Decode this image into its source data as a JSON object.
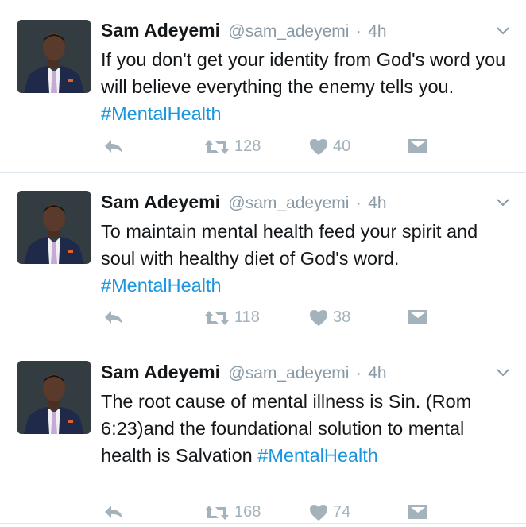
{
  "tweets": [
    {
      "name": "Sam Adeyemi",
      "handle": "@sam_adeyemi",
      "separator": "·",
      "time": "4h",
      "text": "If you don't get your identity from God's word you will believe everything the enemy tells you.",
      "hashtag": "#MentalHealth",
      "retweets": "128",
      "likes": "40"
    },
    {
      "name": "Sam Adeyemi",
      "handle": "@sam_adeyemi",
      "separator": "·",
      "time": "4h",
      "text": "To maintain mental health feed your spirit and soul with healthy diet of God's word.",
      "hashtag": "#MentalHealth",
      "retweets": "118",
      "likes": "38"
    },
    {
      "name": "Sam Adeyemi",
      "handle": "@sam_adeyemi",
      "separator": "·",
      "time": "4h",
      "text": "The root cause of mental illness is Sin. (Rom 6:23)and the foundational solution to mental health is Salvation",
      "hashtag": "#MentalHealth",
      "retweets": "168",
      "likes": "74"
    }
  ],
  "icons": {
    "reply": "reply-icon",
    "retweet": "retweet-icon",
    "like": "heart-icon",
    "dm": "envelope-icon",
    "more": "chevron-down-icon"
  },
  "colors": {
    "name": "#14171a",
    "meta": "#8899a6",
    "hashtag": "#1b95e0",
    "action": "#a4b2bb",
    "divider": "#e1e8ed"
  }
}
